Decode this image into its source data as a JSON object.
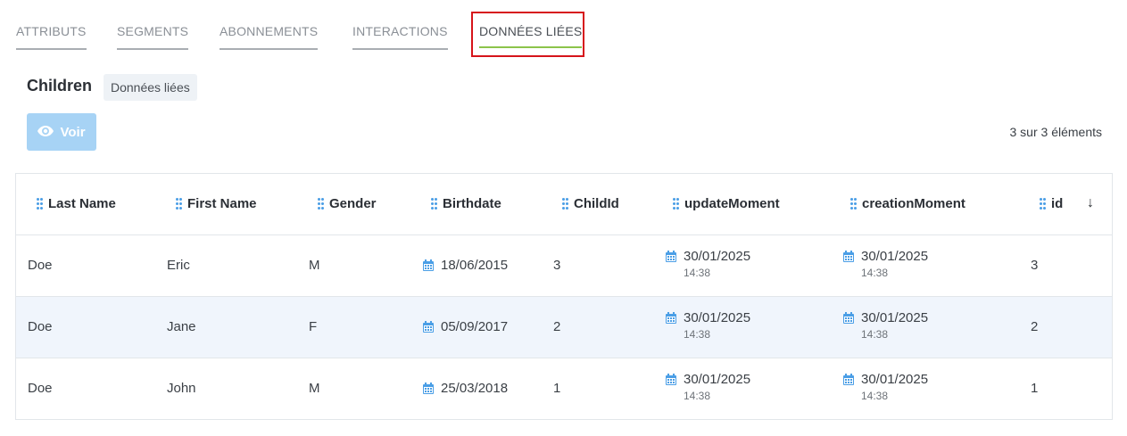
{
  "tabs": [
    {
      "label": "ATTRIBUTS",
      "active": false
    },
    {
      "label": "SEGMENTS",
      "active": false
    },
    {
      "label": "ABONNEMENTS",
      "active": false
    },
    {
      "label": "INTERACTIONS",
      "active": false
    },
    {
      "label": "DONNÉES LIÉES",
      "active": true
    }
  ],
  "section": {
    "title": "Children",
    "badge": "Données liées",
    "view_button": "Voir",
    "count_text": "3 sur 3 éléments"
  },
  "table": {
    "columns": [
      "Last Name",
      "First Name",
      "Gender",
      "Birthdate",
      "ChildId",
      "updateMoment",
      "creationMoment",
      "id"
    ],
    "sort_icon": "arrow-down-icon",
    "rows": [
      {
        "last_name": "Doe",
        "first_name": "Eric",
        "gender": "M",
        "birthdate": "18/06/2015",
        "child_id": "3",
        "update_date": "30/01/2025",
        "update_time": "14:38",
        "creation_date": "30/01/2025",
        "creation_time": "14:38",
        "id": "3"
      },
      {
        "last_name": "Doe",
        "first_name": "Jane",
        "gender": "F",
        "birthdate": "05/09/2017",
        "child_id": "2",
        "update_date": "30/01/2025",
        "update_time": "14:38",
        "creation_date": "30/01/2025",
        "creation_time": "14:38",
        "id": "2"
      },
      {
        "last_name": "Doe",
        "first_name": "John",
        "gender": "M",
        "birthdate": "25/03/2018",
        "child_id": "1",
        "update_date": "30/01/2025",
        "update_time": "14:38",
        "creation_date": "30/01/2025",
        "creation_time": "14:38",
        "id": "1"
      }
    ]
  },
  "colors": {
    "accent": "#4a9ee6",
    "active_tab_underline": "#8cc44a",
    "highlight_box": "#d6141a",
    "view_button": "#a7d3f5",
    "alt_row": "#f0f5fc"
  }
}
